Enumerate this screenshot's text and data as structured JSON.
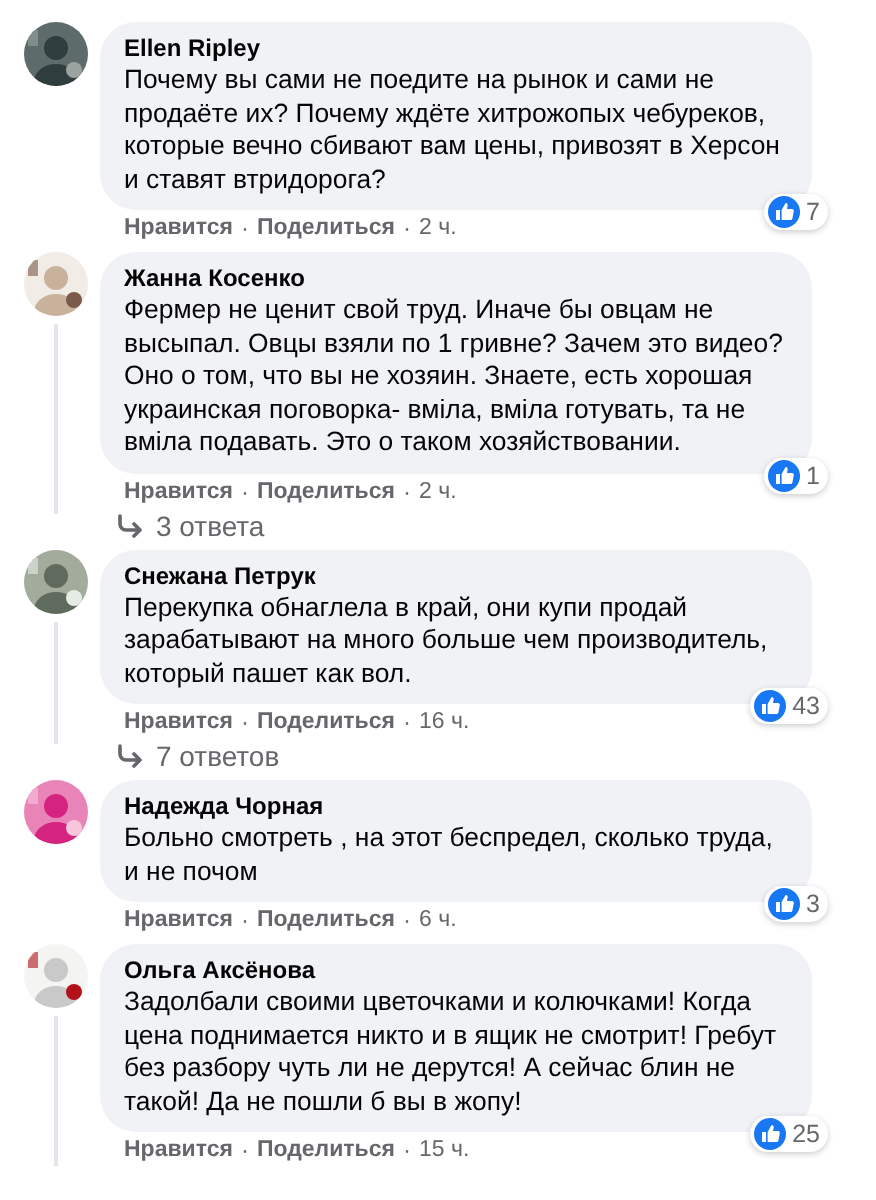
{
  "action_separator": "·",
  "comments": [
    {
      "author": "Ellen Ripley",
      "text": "Почему вы сами не поедите на рынок и сами не продаёте их? Почему ждёте хитрожопых чебуреков, которые вечно сбивают вам цены, привозят в Херсон и ставят втридорога?",
      "likes": "7",
      "actions": [
        "Нравится",
        "Поделиться",
        "2 ч."
      ],
      "thread": false
    },
    {
      "author": "Жанна Косенко",
      "text": "Фермер не ценит свой труд. Иначе бы овцам не высыпал. Овцы взяли по 1 гривне? Зачем это видео? Оно о том, что вы не хозяин. Знаете, есть хорошая украинская поговорка- вміла, вміла готувать, та не вміла подавать. Это о таком хозяйствовании.",
      "likes": "1",
      "actions": [
        "Нравится",
        "Поделиться",
        "2 ч."
      ],
      "thread": true,
      "replies": "3 ответа"
    },
    {
      "author": "Снежана Петрук",
      "text": "Перекупка обнаглела в край, они купи продай зарабатывают на много больше чем производитель, который пашет как вол.",
      "likes": "43",
      "actions": [
        "Нравится",
        "Поделиться",
        "16 ч."
      ],
      "thread": true,
      "replies": "7 ответов"
    },
    {
      "author": "Надежда Чорная",
      "text": "Больно смотреть , на этот беспредел, сколько труда, и не почом",
      "likes": "3",
      "actions": [
        "Нравится",
        "Поделиться",
        "6 ч."
      ],
      "thread": false
    },
    {
      "author": "Ольга Аксёнова",
      "text": "Задолбали своими цветочками и колючками! Когда цена поднимается никто и в ящик не смотрит! Гребут без разбору чуть ли не дерутся! А сейчас блин не такой! Да не пошли б вы в жопу!",
      "likes": "25",
      "actions": [
        "Нравится",
        "Поделиться",
        "15 ч."
      ],
      "thread": true
    }
  ]
}
